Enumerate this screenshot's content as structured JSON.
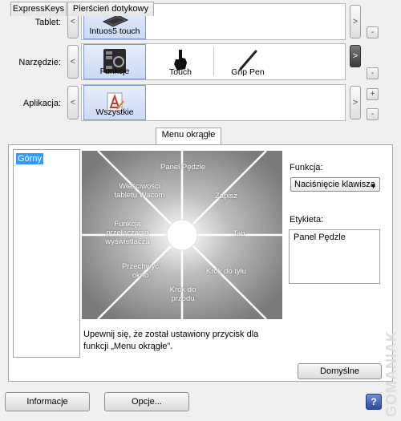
{
  "rows": {
    "tablet": {
      "label": "Tablet:",
      "items": [
        "Intuos5 touch"
      ]
    },
    "tool": {
      "label": "Narzędzie:",
      "items": [
        "Funkcje",
        "Touch",
        "Grip Pen"
      ]
    },
    "app": {
      "label": "Aplikacja:",
      "items": [
        "Wszystkie"
      ]
    }
  },
  "arrows": {
    "left": "<",
    "right": ">"
  },
  "small_buttons": {
    "minus": "-",
    "plus": "+"
  },
  "tabs": [
    "ExpressKeys",
    "Pierścień dotykowy",
    "Menu okrągłe"
  ],
  "active_tab": 2,
  "list": {
    "selected": "Górny"
  },
  "radial_menu": {
    "segments": [
      "Panel Pędzle",
      "Zapisz",
      "Tab",
      "Krok do tyłu",
      "Krok do przodu",
      "Przechwyć okno",
      "Funkcja przełączania wyświetlacza",
      "Właściwości tabletu Wacom"
    ]
  },
  "note": "Upewnij się, że został ustawiony przycisk dla funkcji „Menu okrągłe”.",
  "function": {
    "label": "Funkcja:",
    "value": "Naciśnięcie klawisza"
  },
  "caption": {
    "label": "Etykieta:",
    "value": "Panel Pędzle"
  },
  "buttons": {
    "default": "Domyślne",
    "info": "Informacje",
    "options": "Opcje...",
    "help": "?"
  },
  "watermark": "GOMANIAK"
}
